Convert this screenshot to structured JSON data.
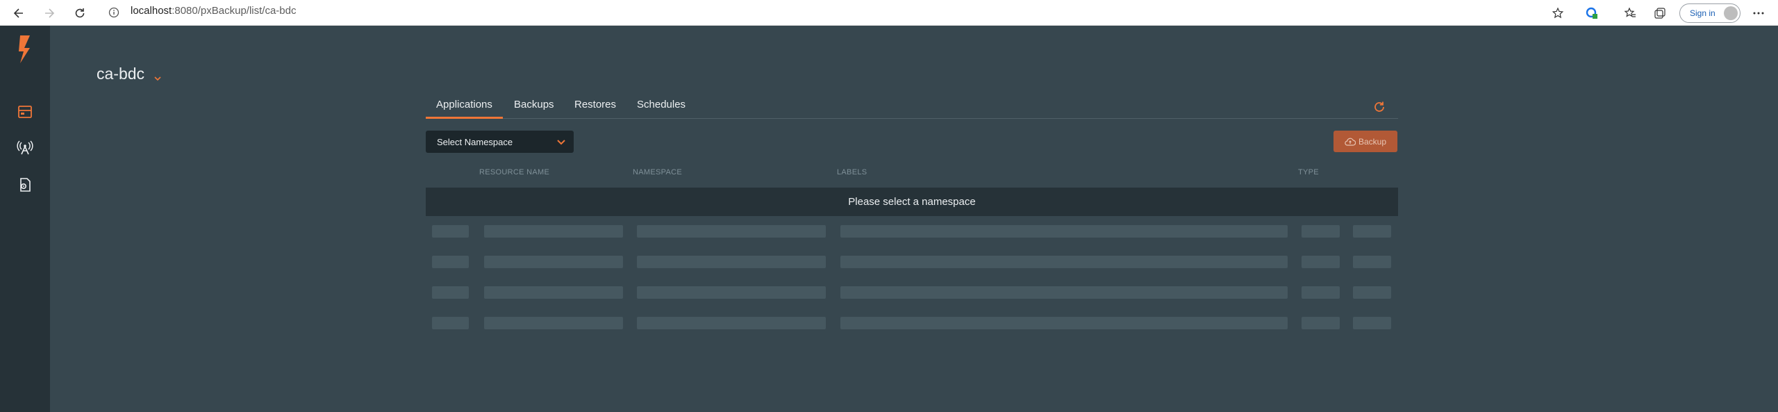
{
  "browser": {
    "url_host": "localhost",
    "url_path": ":8080/pxBackup/list/ca-bdc",
    "signin_label": "Sign in"
  },
  "sidebar": {
    "items": [
      {
        "name": "portworx-logo",
        "icon": "portworx-logo-icon"
      },
      {
        "name": "backups-nav",
        "icon": "server-icon"
      },
      {
        "name": "clusters-nav",
        "icon": "antenna-icon"
      },
      {
        "name": "settings-nav",
        "icon": "document-gear-icon"
      }
    ]
  },
  "page": {
    "cluster_name": "ca-bdc"
  },
  "tabs": [
    {
      "label": "Applications",
      "active": true
    },
    {
      "label": "Backups",
      "active": false
    },
    {
      "label": "Restores",
      "active": false
    },
    {
      "label": "Schedules",
      "active": false
    }
  ],
  "toolbar": {
    "namespace_placeholder": "Select Namespace",
    "backup_label": "Backup"
  },
  "table": {
    "columns": [
      "RESOURCE NAME",
      "NAMESPACE",
      "LABELS",
      "TYPE"
    ],
    "empty_message": "Please select a namespace",
    "skeleton_rows": 4
  },
  "colors": {
    "accent": "#ef7638",
    "background": "#37474f",
    "sidebar": "#263238",
    "backup_button": "#b25936"
  }
}
